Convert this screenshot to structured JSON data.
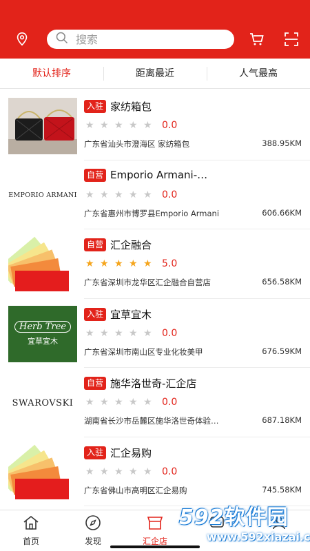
{
  "header": {
    "search_placeholder": "搜索",
    "location_icon": "location-pin-icon",
    "cart_icon": "cart-icon",
    "scan_icon": "scan-icon",
    "accent": "#e2231a"
  },
  "sort_tabs": [
    {
      "label": "默认排序",
      "active": true
    },
    {
      "label": "距离最近",
      "active": false
    },
    {
      "label": "人气最高",
      "active": false
    }
  ],
  "stores": [
    {
      "badge": "入驻",
      "name": "家纺箱包",
      "score": "0.0",
      "stars": 0,
      "address": "广东省汕头市澄海区 家纺箱包",
      "distance": "388.95KM",
      "image": "handbags-photo"
    },
    {
      "badge": "自营",
      "name": "Emporio Armani-…",
      "score": "0.0",
      "stars": 0,
      "address": "广东省惠州市博罗县Emporio Armani",
      "distance": "606.66KM",
      "image": "emporio-armani-logo",
      "logo_text": "EMPORIO ARMANI"
    },
    {
      "badge": "自营",
      "name": "汇企融合",
      "score": "5.0",
      "stars": 5,
      "address": "广东省深圳市龙华区汇企融合自营店",
      "distance": "656.58KM",
      "image": "color-swatch-fan"
    },
    {
      "badge": "入驻",
      "name": "宜草宜木",
      "score": "0.0",
      "stars": 0,
      "address": "广东省深圳市南山区专业化妆美甲",
      "distance": "676.59KM",
      "image": "herb-tree-logo",
      "logo_text": "Herb Tree",
      "logo_sub": "宜草宜木"
    },
    {
      "badge": "自营",
      "name": "施华洛世奇-汇企店",
      "score": "0.0",
      "stars": 0,
      "address": "湖南省长沙市岳麓区施华洛世奇体验…",
      "distance": "687.18KM",
      "image": "swarovski-logo",
      "logo_text": "SWAROVSKI"
    },
    {
      "badge": "入驻",
      "name": "汇企易购",
      "score": "0.0",
      "stars": 0,
      "address": "广东省佛山市高明区汇企易购",
      "distance": "745.58KM",
      "image": "color-swatch-fan"
    }
  ],
  "tabbar": [
    {
      "label": "首页",
      "icon": "home-icon",
      "active": false
    },
    {
      "label": "发现",
      "icon": "compass-icon",
      "active": false
    },
    {
      "label": "汇企店",
      "icon": "store-icon",
      "active": true
    },
    {
      "label": "",
      "icon": "message-icon",
      "active": false
    },
    {
      "label": "",
      "icon": "user-icon",
      "active": false
    }
  ],
  "watermark": {
    "brand_num": "592",
    "brand_text": "软件园",
    "url": "www.592xiazai.com"
  }
}
